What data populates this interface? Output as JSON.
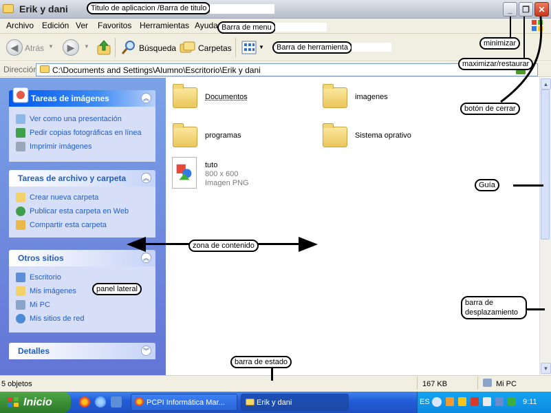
{
  "window": {
    "title": "Erik y dani",
    "min_glyph": "_",
    "max_glyph": "❐",
    "close_glyph": "✕"
  },
  "menu": [
    "Archivo",
    "Edición",
    "Ver",
    "Favoritos",
    "Herramientas",
    "Ayuda"
  ],
  "toolbar": {
    "back": "Atrás",
    "search": "Búsqueda",
    "folders": "Carpetas"
  },
  "address": {
    "label": "Dirección",
    "path": "C:\\Documents and Settings\\Alumno\\Escritorio\\Erik y dani"
  },
  "sidepanel": {
    "image_tasks": {
      "title": "Tareas de imágenes",
      "items": [
        "Ver como una presentación",
        "Pedir copias fotográficas en línea",
        "Imprimir imágenes"
      ]
    },
    "file_tasks": {
      "title": "Tareas de archivo y carpeta",
      "items": [
        "Crear nueva carpeta",
        "Publicar esta carpeta en Web",
        "Compartir esta carpeta"
      ]
    },
    "other_places": {
      "title": "Otros sitios",
      "items": [
        "Escritorio",
        "Mis imágenes",
        "Mi PC",
        "Mis sitios de red"
      ]
    },
    "details": {
      "title": "Detalles"
    }
  },
  "content": {
    "items": [
      {
        "name": "Documentos",
        "type": "folder"
      },
      {
        "name": "imagenes",
        "type": "folder"
      },
      {
        "name": "programas",
        "type": "folder"
      },
      {
        "name": "Sistema oprativo",
        "type": "folder"
      },
      {
        "name": "tuto",
        "type": "file",
        "dimensions": "800 x 600",
        "kind": "Imagen PNG"
      }
    ]
  },
  "statusbar": {
    "count": "5 objetos",
    "size": "167 KB",
    "location": "Mi PC"
  },
  "taskbar": {
    "start": "Inicio",
    "windows": [
      "PCPI Informática Mar...",
      "Erik y dani"
    ],
    "lang": "ES",
    "clock": "9:11"
  },
  "annotations": {
    "title_label": "Titulo de aplicacion /Barra de titulo",
    "menu_label": "Barra de menu",
    "toolbar_label": "Barra de herramienta",
    "minimize_label": "minimizar",
    "maximize_label": "maximizar/restaurar",
    "close_label": "botón de cerrar",
    "guide_label": "Guía",
    "content_label": "zona de contenido",
    "sidepanel_label": "panel lateral",
    "scrollbar_label": "barra de desplazamiento",
    "statusbar_label": "barra de estado"
  }
}
